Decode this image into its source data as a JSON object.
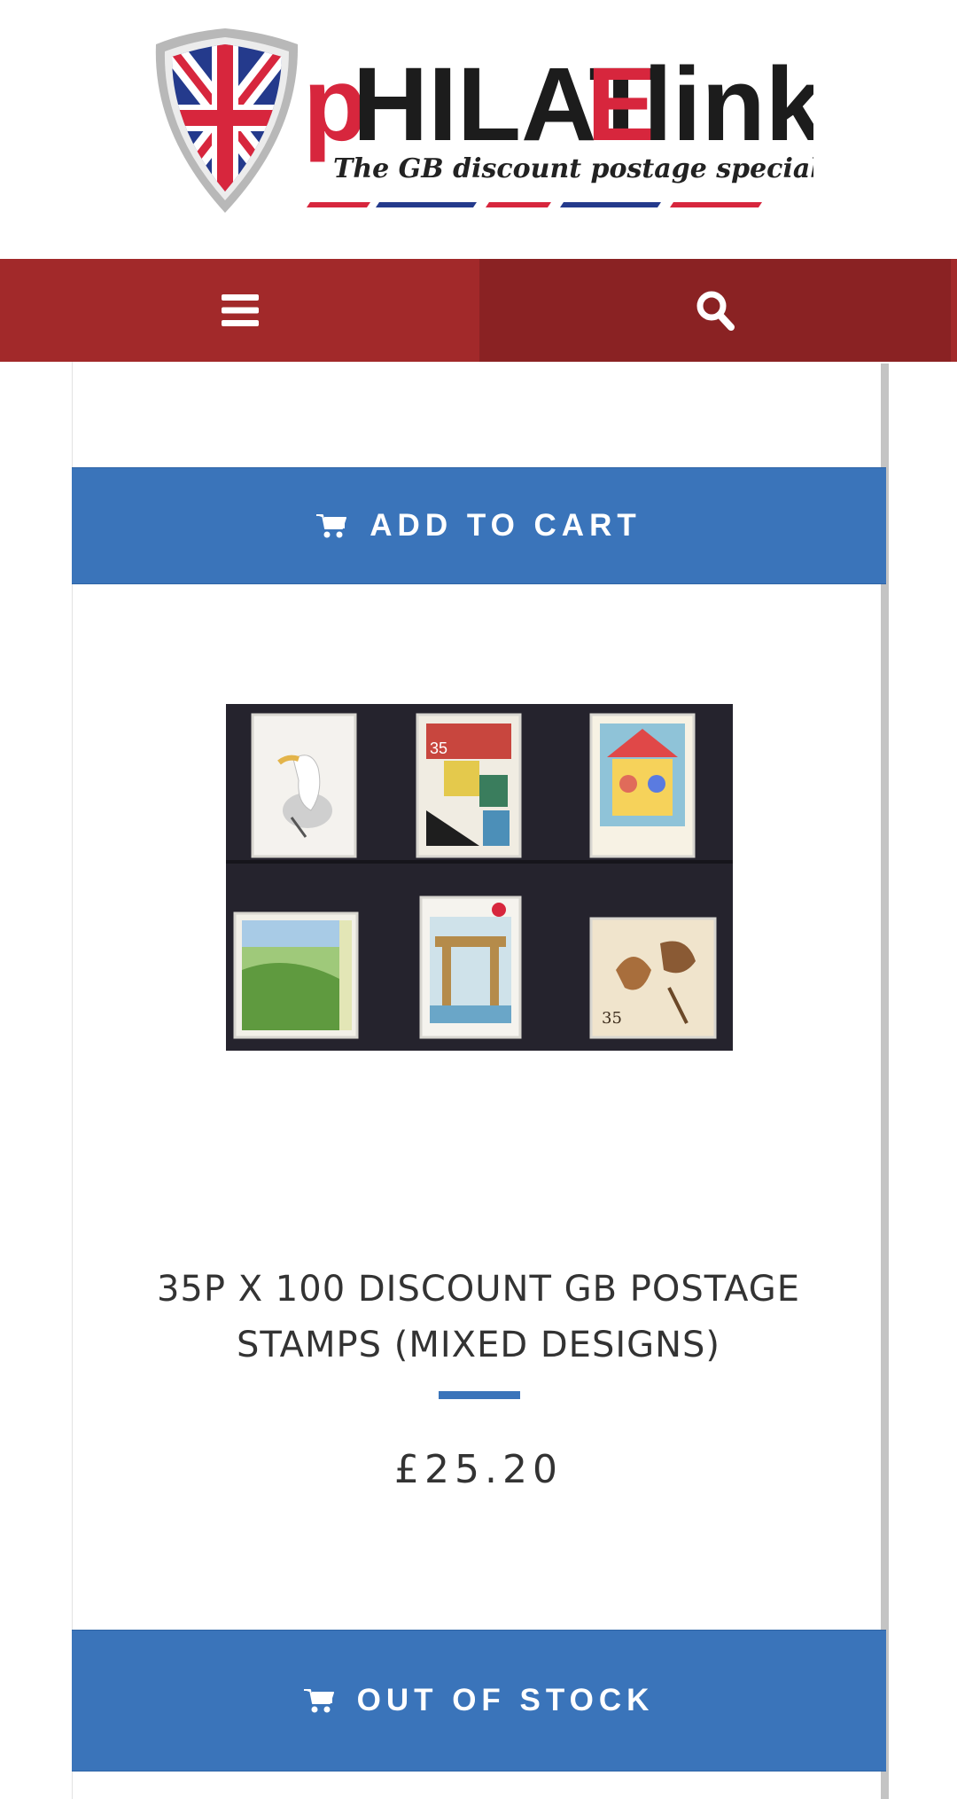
{
  "header": {
    "logo": {
      "wordmark_parts": [
        "p",
        "HILAT",
        "E",
        "link"
      ],
      "tagline": "The GB discount postage specialists",
      "icon": "union-jack-shield-icon"
    }
  },
  "navbar": {
    "menu_icon": "hamburger-menu-icon",
    "search_icon": "search-icon"
  },
  "product": {
    "add_to_cart_label": "ADD TO CART",
    "add_to_cart_icon": "cart-icon",
    "image_alt": "stamps-image",
    "title": "35P X 100 DISCOUNT GB POSTAGE STAMPS (MIXED DESIGNS)",
    "price": "£25.20",
    "stock_button_label": "OUT OF STOCK",
    "stock_button_icon": "cart-icon"
  },
  "colors": {
    "nav_red": "#a2292a",
    "nav_red_dark": "#8a2223",
    "button_blue": "#3a74ba",
    "logo_red": "#d7263d",
    "logo_dark": "#222222",
    "text": "#333333"
  }
}
